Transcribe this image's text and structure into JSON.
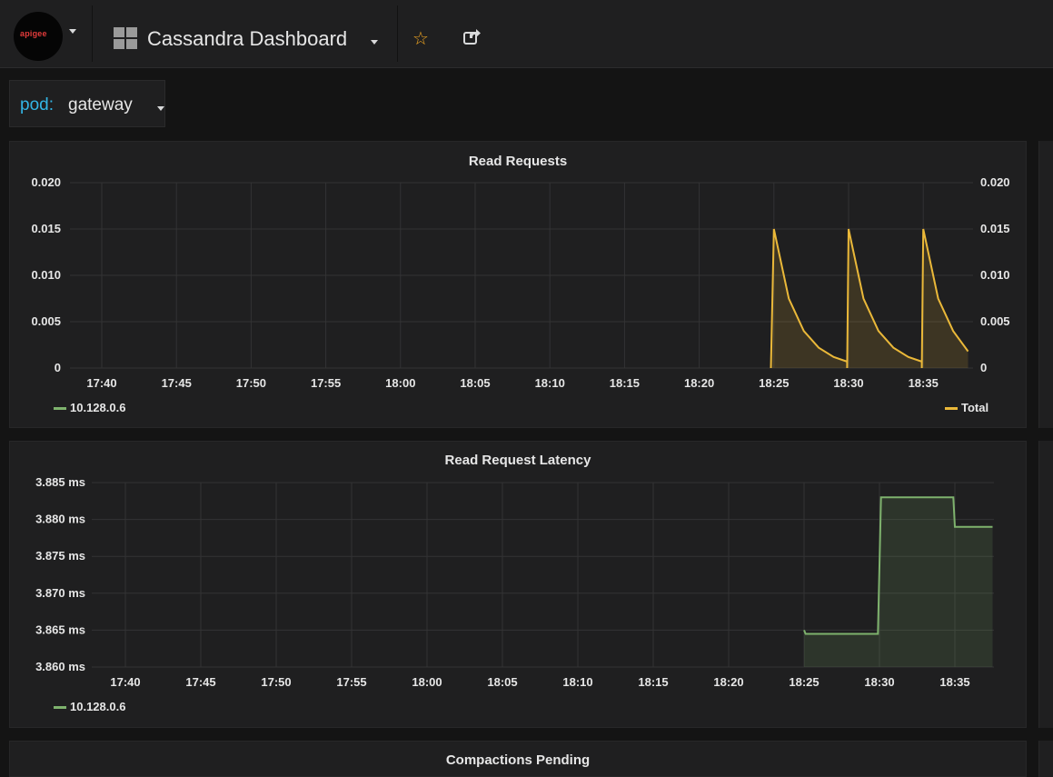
{
  "header": {
    "logo_text": "apigee",
    "dashboard_title": "Cassandra Dashboard",
    "star_icon": "star-icon",
    "share_icon": "share-icon"
  },
  "template_var": {
    "name": "pod:",
    "value": "gateway"
  },
  "colors": {
    "yellow_series": "#eab839",
    "green_series": "#7eb26d",
    "variable_name": "#33b5e5",
    "star": "#f2a722"
  },
  "panels": [
    {
      "title": "Read Requests",
      "legend_left": "10.128.0.6",
      "legend_right": "Total"
    },
    {
      "title": "Read Request Latency",
      "legend_left": "10.128.0.6"
    },
    {
      "title": "Compactions Pending"
    }
  ],
  "chart_data": [
    {
      "type": "line",
      "title": "Read Requests",
      "x_ticks": [
        "17:40",
        "17:45",
        "17:50",
        "17:55",
        "18:00",
        "18:05",
        "18:10",
        "18:15",
        "18:20",
        "18:25",
        "18:30",
        "18:35"
      ],
      "y_ticks": [
        "0.020",
        "0.015",
        "0.010",
        "0.005",
        "0"
      ],
      "ylim": [
        0,
        0.02
      ],
      "grid": true,
      "legend": [
        "10.128.0.6",
        "Total"
      ],
      "series": [
        {
          "name": "Total",
          "color": "#eab839",
          "fill": true,
          "points": [
            [
              "18:24.8",
              0
            ],
            [
              "18:25",
              0.015
            ],
            [
              "18:26",
              0.0075
            ],
            [
              "18:27",
              0.004
            ],
            [
              "18:28",
              0.0022
            ],
            [
              "18:29",
              0.0012
            ],
            [
              "18:29.9",
              0.0007
            ],
            [
              "18:29.9",
              0
            ],
            [
              "18:30",
              0.015
            ],
            [
              "18:31",
              0.0075
            ],
            [
              "18:32",
              0.004
            ],
            [
              "18:33",
              0.0022
            ],
            [
              "18:34",
              0.0012
            ],
            [
              "18:34.9",
              0.0007
            ],
            [
              "18:34.9",
              0
            ],
            [
              "18:35",
              0.015
            ],
            [
              "18:36",
              0.0075
            ],
            [
              "18:37",
              0.004
            ],
            [
              "18:38",
              0.0018
            ]
          ]
        }
      ]
    },
    {
      "type": "line",
      "title": "Read Request Latency",
      "x_ticks": [
        "17:40",
        "17:45",
        "17:50",
        "17:55",
        "18:00",
        "18:05",
        "18:10",
        "18:15",
        "18:20",
        "18:25",
        "18:30",
        "18:35"
      ],
      "y_ticks": [
        "3.885 ms",
        "3.880 ms",
        "3.875 ms",
        "3.870 ms",
        "3.865 ms",
        "3.860 ms"
      ],
      "ylim": [
        3.86,
        3.885
      ],
      "grid": true,
      "legend": [
        "10.128.0.6"
      ],
      "series": [
        {
          "name": "10.128.0.6",
          "color": "#7eb26d",
          "fill": true,
          "points": [
            [
              "18:25",
              3.865
            ],
            [
              "18:25.1",
              3.8645
            ],
            [
              "18:29.9",
              3.8645
            ],
            [
              "18:30.1",
              3.883
            ],
            [
              "18:34.9",
              3.883
            ],
            [
              "18:35",
              3.879
            ],
            [
              "18:37.5",
              3.879
            ]
          ]
        }
      ]
    }
  ]
}
